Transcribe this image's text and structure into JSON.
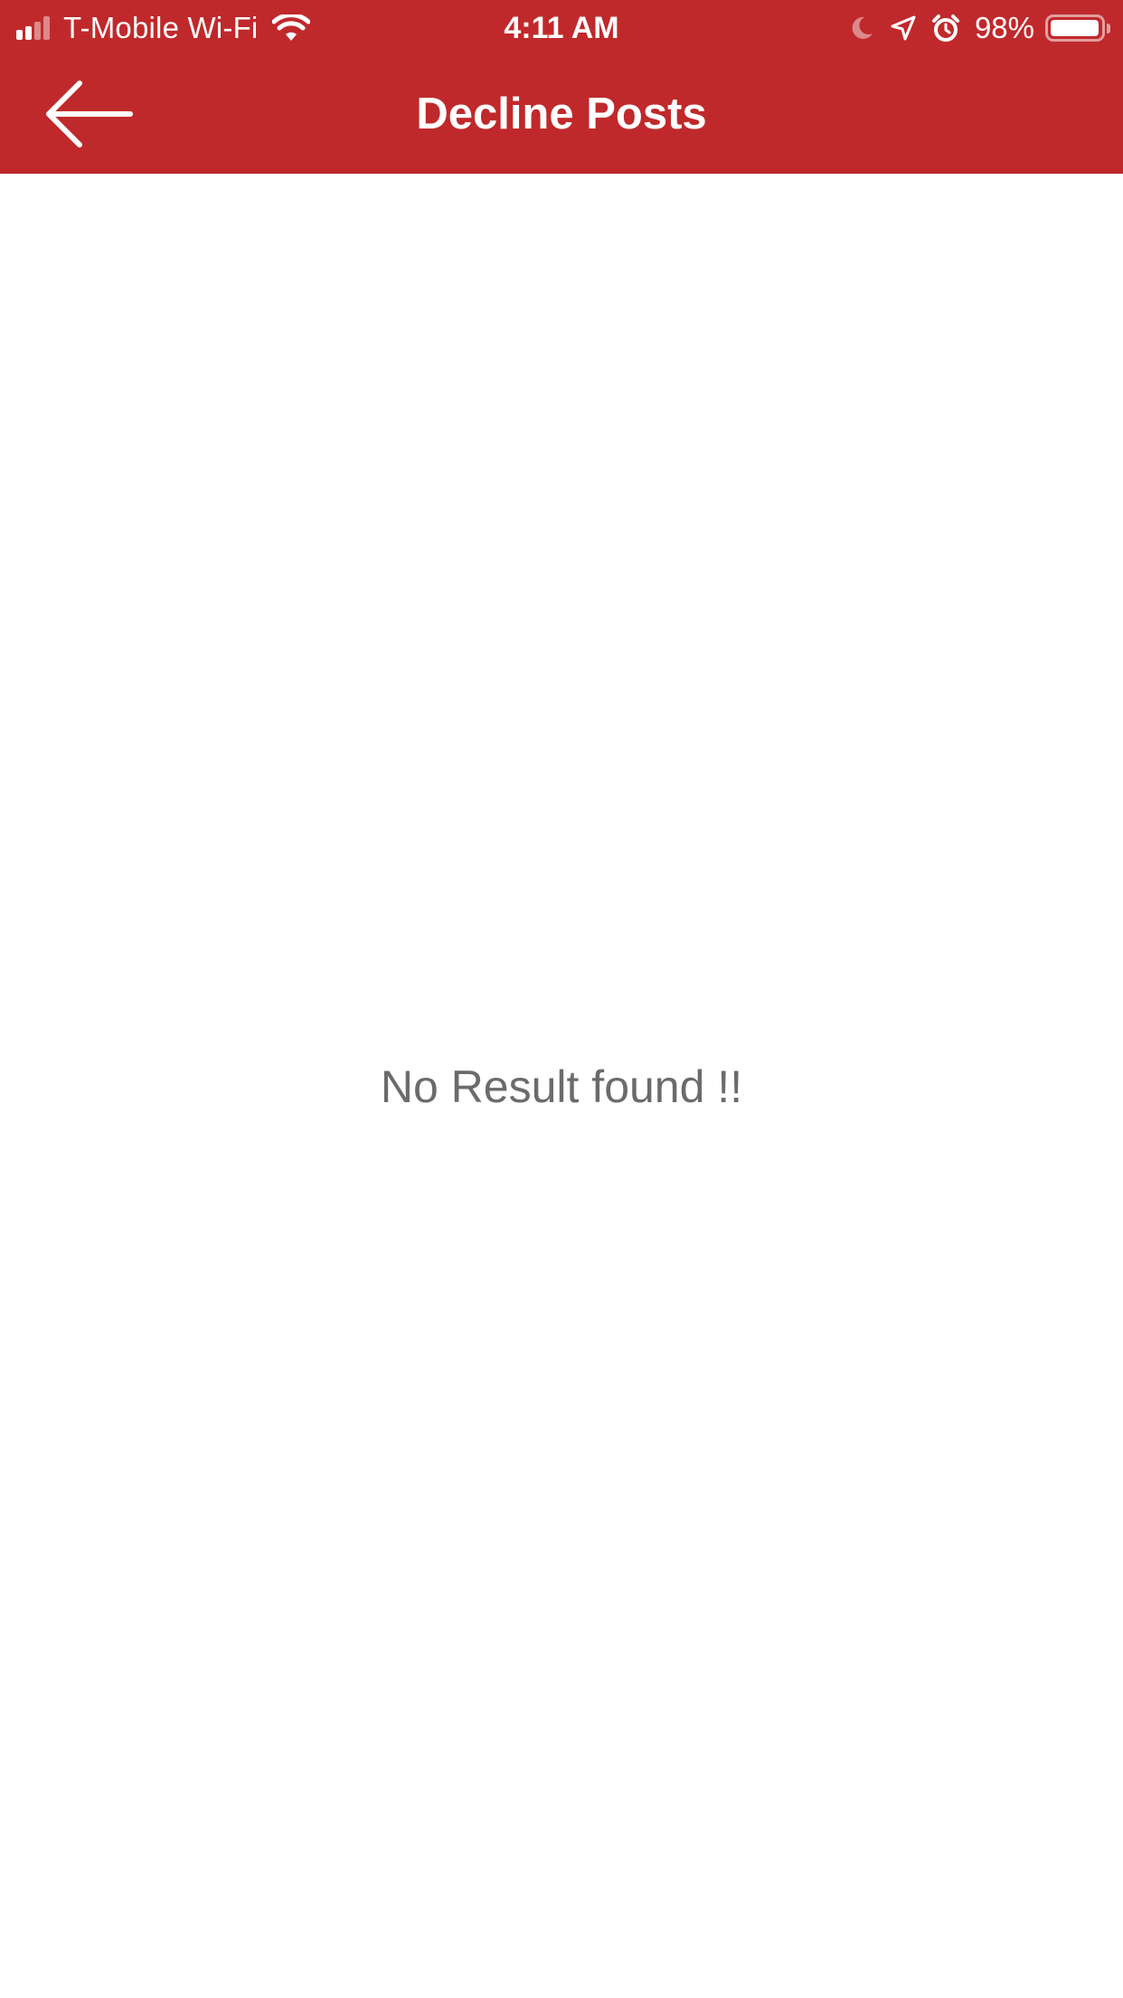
{
  "status_bar": {
    "carrier": "T-Mobile Wi-Fi",
    "time": "4:11 AM",
    "battery_percent": "98%",
    "battery_level": 0.98,
    "icons": [
      "signal-icon",
      "wifi-icon",
      "do-not-disturb-icon",
      "location-icon",
      "alarm-icon",
      "battery-icon"
    ]
  },
  "nav_bar": {
    "title": "Decline Posts",
    "back_icon": "back-arrow-icon",
    "background_color": "#c0292b"
  },
  "content": {
    "empty_message": "No Result found !!",
    "text_color": "#6b6b6b"
  }
}
